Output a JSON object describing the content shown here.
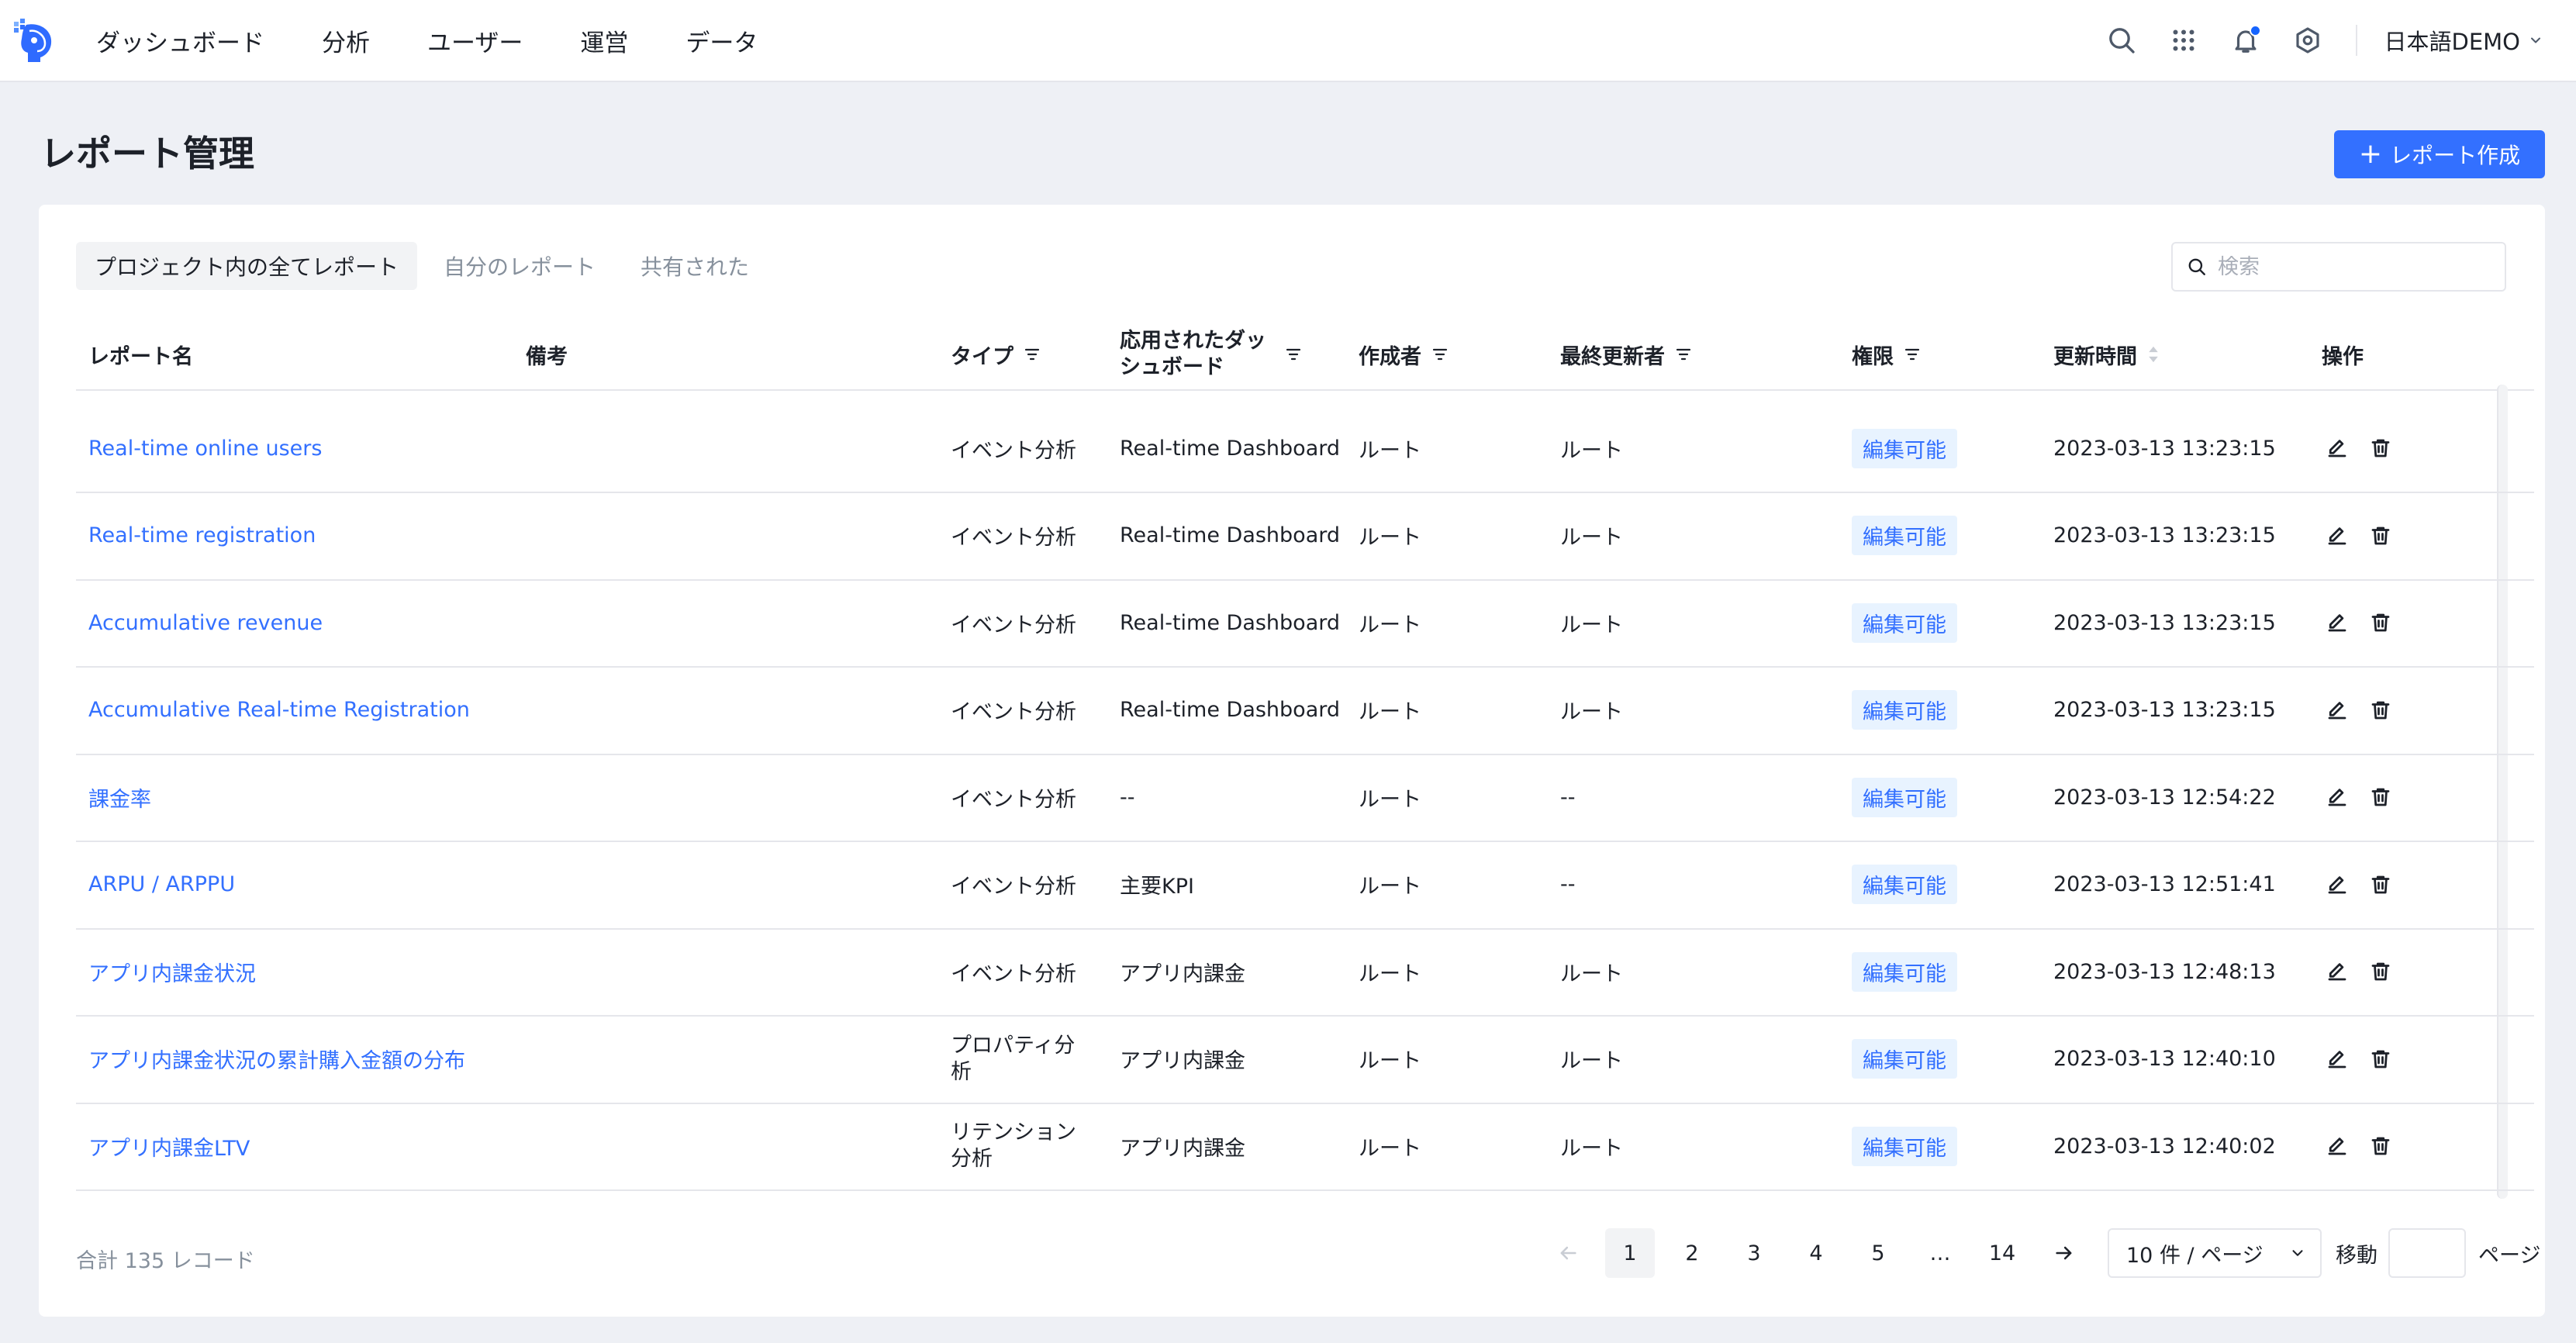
{
  "nav": {
    "items": [
      {
        "label": "ダッシュボード"
      },
      {
        "label": "分析"
      },
      {
        "label": "ユーザー"
      },
      {
        "label": "運営"
      },
      {
        "label": "データ"
      }
    ],
    "user_label": "日本語DEMO",
    "icons": [
      "search-icon",
      "apps-grid-icon",
      "bell-icon",
      "settings-icon",
      "chevron-down-icon"
    ]
  },
  "page": {
    "title": "レポート管理",
    "create_button": "レポート作成"
  },
  "tabs": [
    {
      "label": "プロジェクト内の全てレポート",
      "active": true
    },
    {
      "label": "自分のレポート",
      "active": false
    },
    {
      "label": "共有された",
      "active": false
    }
  ],
  "search": {
    "placeholder": "検索"
  },
  "table": {
    "columns": {
      "name": "レポート名",
      "note": "備考",
      "type": "タイプ",
      "dashboard": "応用されたダッシュボード",
      "creator": "作成者",
      "updater": "最終更新者",
      "permission": "権限",
      "updated": "更新時間",
      "action": "操作"
    },
    "rows": [
      {
        "name": "Real-time online users",
        "type": "イベント分析",
        "dashboard": "Real-time Dashboard",
        "creator": "ルート",
        "updater": "ルート",
        "permission": "編集可能",
        "updated": "2023-03-13 13:23:15"
      },
      {
        "name": "Real-time registration",
        "type": "イベント分析",
        "dashboard": "Real-time Dashboard",
        "creator": "ルート",
        "updater": "ルート",
        "permission": "編集可能",
        "updated": "2023-03-13 13:23:15"
      },
      {
        "name": "Accumulative revenue",
        "type": "イベント分析",
        "dashboard": "Real-time Dashboard",
        "creator": "ルート",
        "updater": "ルート",
        "permission": "編集可能",
        "updated": "2023-03-13 13:23:15"
      },
      {
        "name": "Accumulative Real-time Registration",
        "type": "イベント分析",
        "dashboard": "Real-time Dashboard",
        "creator": "ルート",
        "updater": "ルート",
        "permission": "編集可能",
        "updated": "2023-03-13 13:23:15"
      },
      {
        "name": "課金率",
        "type": "イベント分析",
        "dashboard": "--",
        "creator": "ルート",
        "updater": "--",
        "permission": "編集可能",
        "updated": "2023-03-13 12:54:22"
      },
      {
        "name": "ARPU / ARPPU",
        "type": "イベント分析",
        "dashboard": "主要KPI",
        "creator": "ルート",
        "updater": "--",
        "permission": "編集可能",
        "updated": "2023-03-13 12:51:41"
      },
      {
        "name": "アプリ内課金状況",
        "type": "イベント分析",
        "dashboard": "アプリ内課金",
        "creator": "ルート",
        "updater": "ルート",
        "permission": "編集可能",
        "updated": "2023-03-13 12:48:13"
      },
      {
        "name": "アプリ内課金状況の累計購入金額の分布",
        "type": "プロパティ分析",
        "dashboard": "アプリ内課金",
        "creator": "ルート",
        "updater": "ルート",
        "permission": "編集可能",
        "updated": "2023-03-13 12:40:10"
      },
      {
        "name": "アプリ内課金LTV",
        "type": "リテンション分析",
        "dashboard": "アプリ内課金",
        "creator": "ルート",
        "updater": "ルート",
        "permission": "編集可能",
        "updated": "2023-03-13 12:40:02"
      }
    ]
  },
  "footer": {
    "total_label": "合計 135 レコード",
    "pages": [
      "1",
      "2",
      "3",
      "4",
      "5",
      "…",
      "14"
    ],
    "current_page": "1",
    "page_size": "10 件 / ページ",
    "goto_label": "移動",
    "goto_value": "",
    "goto_suffix": "ページ"
  },
  "colors": {
    "accent": "#3370ff",
    "badge_bg": "#e8f3ff",
    "page_bg": "#eef0f5"
  }
}
